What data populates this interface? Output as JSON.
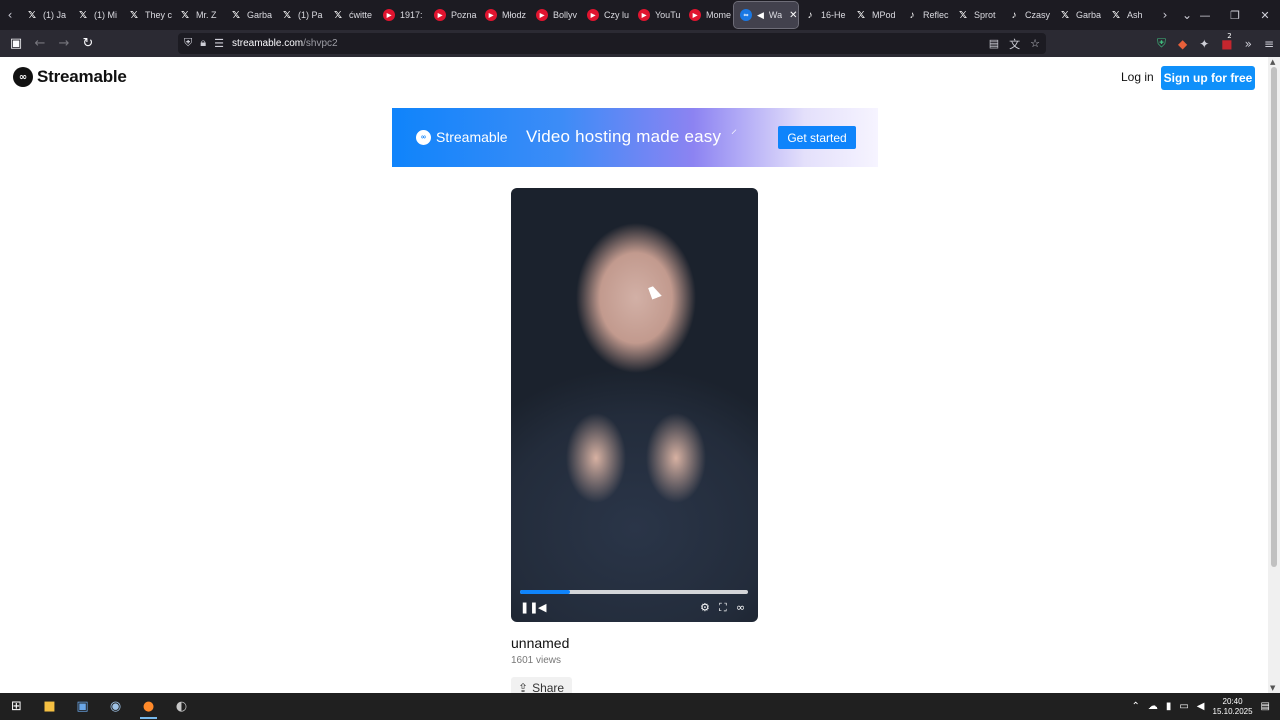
{
  "browser": {
    "tabs": [
      {
        "title": "(1) Ja",
        "icon": "x"
      },
      {
        "title": "(1) Mi",
        "icon": "x"
      },
      {
        "title": "They c",
        "icon": "x"
      },
      {
        "title": "Mr. Z",
        "icon": "x"
      },
      {
        "title": "Garba",
        "icon": "x"
      },
      {
        "title": "(1) Pa",
        "icon": "x"
      },
      {
        "title": "ćwitte",
        "icon": "x"
      },
      {
        "title": "1917:",
        "icon": "yt"
      },
      {
        "title": "Pozna",
        "icon": "yt"
      },
      {
        "title": "Młodz",
        "icon": "yt"
      },
      {
        "title": "Bollyv",
        "icon": "yt"
      },
      {
        "title": "Czy lu",
        "icon": "yt"
      },
      {
        "title": "YouTu",
        "icon": "yt"
      },
      {
        "title": "Mome",
        "icon": "yt"
      },
      {
        "title": "Wa",
        "icon": "st",
        "active": true
      },
      {
        "title": "16-He",
        "icon": "tt"
      },
      {
        "title": "MPod",
        "icon": "x"
      },
      {
        "title": "Reflec",
        "icon": "tt"
      },
      {
        "title": "Sprot",
        "icon": "x"
      },
      {
        "title": "Czasy",
        "icon": "tt"
      },
      {
        "title": "Garba",
        "icon": "x"
      },
      {
        "title": "Ash",
        "icon": "x"
      }
    ],
    "url_host": "streamable.com",
    "url_path": "/shvpc2",
    "extension_badge": "2"
  },
  "site": {
    "logo_text": "Streamable",
    "login_label": "Log in",
    "signup_label": "Sign up for free"
  },
  "banner": {
    "logo_text": "Streamable",
    "tagline": "Video hosting made easy",
    "cta_label": "Get started"
  },
  "video": {
    "progress": 0.22,
    "title": "unnamed",
    "views": "1601 views",
    "share_label": "Share"
  },
  "taskbar": {
    "time": "20:40",
    "date": "15.10.2025"
  },
  "colors": {
    "brand_blue": "#0f90fa",
    "browser_dark": "#1c1b22"
  }
}
